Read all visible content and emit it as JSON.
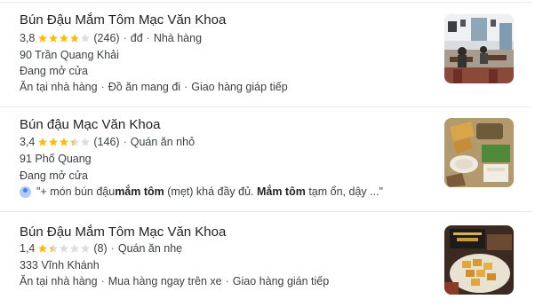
{
  "colors": {
    "star_filled": "#fbbc04",
    "star_empty": "#dadce0"
  },
  "places": [
    {
      "name": "Bún Đậu Mắm Tôm Mạc Văn Khoa",
      "rating": "3,8",
      "stars_value": 3.8,
      "reviews": "(246)",
      "price": "đđ",
      "category": "Nhà hàng",
      "address": "90 Trần Quang Khải",
      "status": "Đang mở cửa",
      "services": [
        "Ăn tại nhà hàng",
        "Đồ ăn mang đi",
        "Giao hàng giáp tiếp"
      ],
      "thumb_icon": "restaurant-interior-photo"
    },
    {
      "name": "Bún đậu Mạc Văn Khoa",
      "rating": "3,4",
      "stars_value": 3.4,
      "reviews": "(146)",
      "category": "Quán ăn nhỏ",
      "address": "91 Phố Quang",
      "status": "Đang mở cửa",
      "review": {
        "part1": "\"+ món bún đậu ",
        "bold1": "mắm tôm",
        "part2": " (mẹt) khá đầy đủ. ",
        "bold2": "Mắm tôm",
        "part3": " tạm ổn, dậy ...\""
      },
      "thumb_icon": "food-platter-photo"
    },
    {
      "name": "Bún Đậu Mắm Tôm Mạc Văn Khoa",
      "rating": "1,4",
      "stars_value": 1.4,
      "reviews": "(8)",
      "category": "Quán ăn nhẹ",
      "address": "333 Vĩnh Khánh",
      "services": [
        "Ăn tại nhà hàng",
        "Mua hàng ngay trên xe",
        "Giao hàng gián tiếp"
      ],
      "thumb_icon": "fried-tofu-photo"
    }
  ]
}
